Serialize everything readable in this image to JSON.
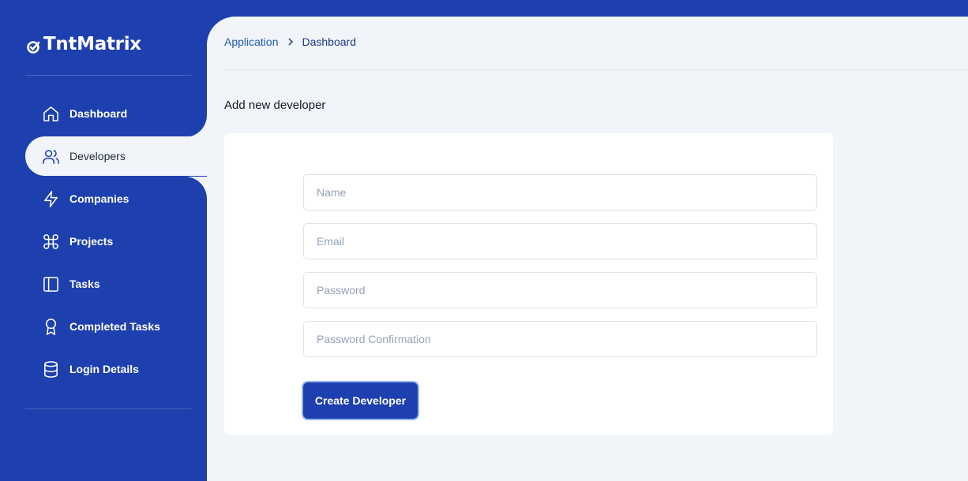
{
  "app": {
    "logo_text": "TntMatrix"
  },
  "sidebar": {
    "items": [
      {
        "label": "Dashboard",
        "icon": "home-icon"
      },
      {
        "label": "Developers",
        "icon": "users-icon"
      },
      {
        "label": "Companies",
        "icon": "zap-icon"
      },
      {
        "label": "Projects",
        "icon": "command-icon"
      },
      {
        "label": "Tasks",
        "icon": "sidebar-panel-icon"
      },
      {
        "label": "Completed Tasks",
        "icon": "award-icon"
      },
      {
        "label": "Login Details",
        "icon": "database-icon"
      }
    ],
    "active_item": "Developers"
  },
  "breadcrumb": {
    "parent": "Application",
    "current": "Dashboard"
  },
  "page": {
    "title": "Add new developer"
  },
  "form": {
    "name_placeholder": "Name",
    "email_placeholder": "Email",
    "password_placeholder": "Password",
    "password_confirmation_placeholder": "Password Confirmation",
    "submit_label": "Create Developer"
  },
  "colors": {
    "primary": "#1e40af",
    "background": "#f1f5f9",
    "card": "#ffffff"
  }
}
